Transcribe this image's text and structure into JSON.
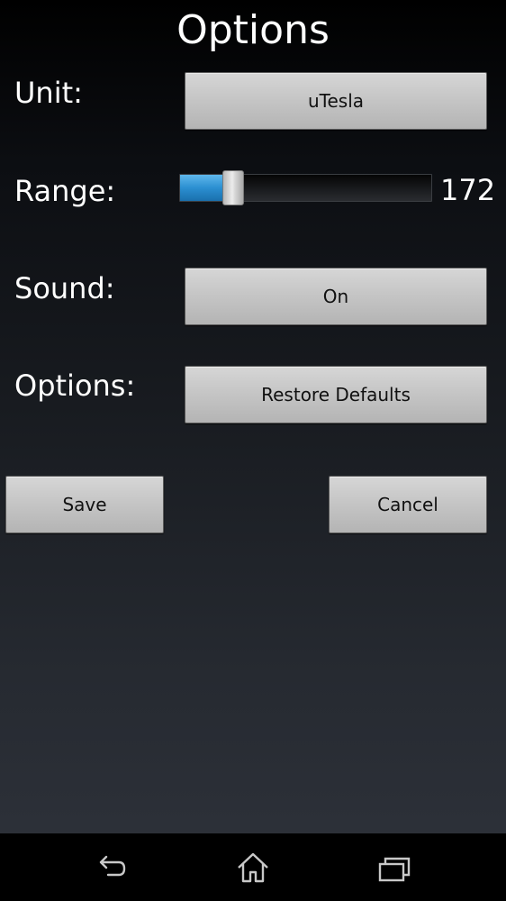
{
  "header": {
    "title": "Options"
  },
  "unit": {
    "label": "Unit:",
    "value": "uTesla"
  },
  "range": {
    "label": "Range:",
    "value": "172",
    "fraction": 0.21
  },
  "sound": {
    "label": "Sound:",
    "value": "On"
  },
  "options": {
    "label": "Options:",
    "button": "Restore Defaults"
  },
  "actions": {
    "save": "Save",
    "cancel": "Cancel"
  },
  "navbar": {
    "icons": [
      "back-icon",
      "home-icon",
      "recent-apps-icon"
    ]
  },
  "colors": {
    "accent": "#2b8fd1",
    "button": "#c6c6c6",
    "navbar": "#000000"
  }
}
